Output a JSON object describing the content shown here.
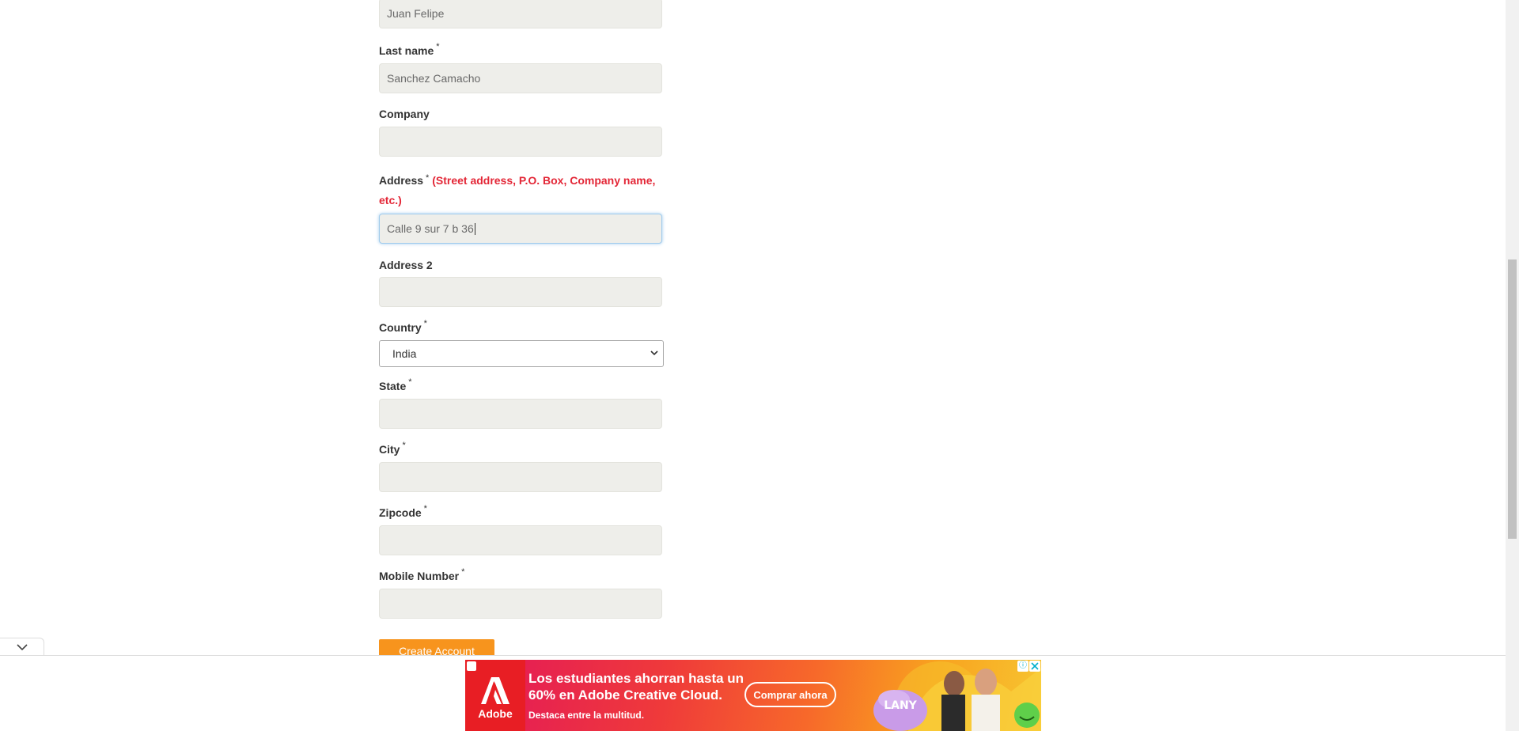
{
  "form": {
    "first_name": {
      "value": "Juan Felipe"
    },
    "last_name": {
      "label": "Last name",
      "required": "*",
      "value": "Sanchez Camacho"
    },
    "company": {
      "label": "Company",
      "value": ""
    },
    "address": {
      "label": "Address",
      "required": "*",
      "hint": "(Street address, P.O. Box, Company name, etc.)",
      "value": "Calle 9 sur 7 b 36"
    },
    "address2": {
      "label": "Address 2",
      "value": ""
    },
    "country": {
      "label": "Country",
      "required": "*",
      "selected": "India"
    },
    "state": {
      "label": "State",
      "required": "*",
      "value": ""
    },
    "city": {
      "label": "City",
      "required": "*",
      "value": ""
    },
    "zipcode": {
      "label": "Zipcode",
      "required": "*",
      "value": ""
    },
    "mobile": {
      "label": "Mobile Number",
      "required": "*",
      "value": ""
    },
    "submit_label": "Create Account"
  },
  "ad": {
    "brand": "Adobe",
    "headline": "Los estudiantes ahorran hasta un 60% en Adobe Creative Cloud.",
    "subline": "Destaca entre la multitud.",
    "cta": "Comprar ahora",
    "art_text": "LANY",
    "info_glyph": "ⓘ",
    "colors": {
      "logo_red": "#e81e24",
      "gradient_start": "#e3165b",
      "gradient_end": "#f7c531"
    }
  },
  "colors": {
    "input_bg": "#eeeeea",
    "button_orange": "#f7941d",
    "hint_red": "#e32636",
    "focus_blue": "#9ecaed"
  }
}
